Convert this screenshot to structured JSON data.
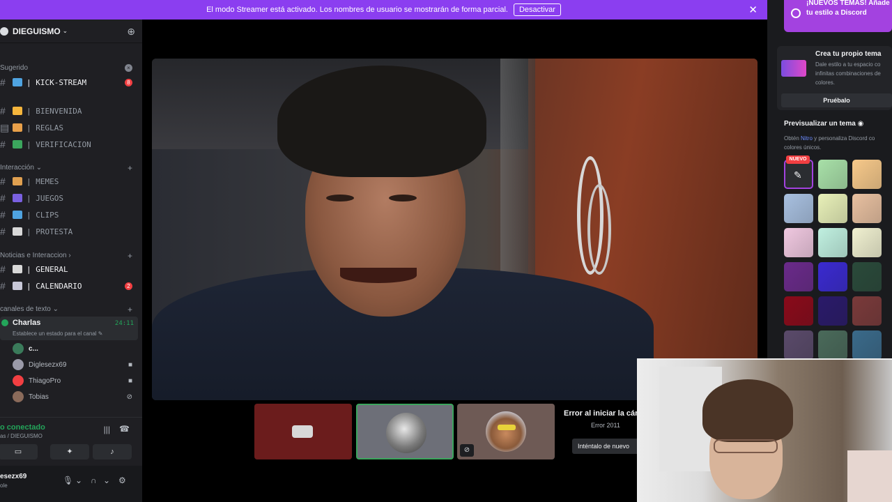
{
  "banner": {
    "text": "El modo Streamer está activado. Los nombres de usuario se mostrarán de forma parcial.",
    "button": "Desactivar",
    "close": "✕"
  },
  "server": {
    "name": "DIEGUISMO",
    "chevron": "⌄"
  },
  "categories": {
    "sugerido": "Sugerido",
    "interaccion": "Interacción",
    "noticias": "Noticias e Interaccion",
    "canales_texto": "canales de texto"
  },
  "channels": [
    {
      "name": "| KICK-STREAM",
      "emoji_color": "#4fa3e0",
      "badge": "8"
    },
    {
      "name": "| BIENVENIDA",
      "emoji_color": "#f5b53c"
    },
    {
      "name": "| REGLAS",
      "emoji_color": "#e8a04a"
    },
    {
      "name": "| VERIFICACION",
      "emoji_color": "#3ba55d"
    },
    {
      "name": "| MEMES",
      "emoji_color": "#e0a050"
    },
    {
      "name": "| JUEGOS",
      "emoji_color": "#7a60e0"
    },
    {
      "name": "| CLIPS",
      "emoji_color": "#4fa3e0"
    },
    {
      "name": "| PROTESTA",
      "emoji_color": "#d8d8d8"
    },
    {
      "name": "| GENERAL",
      "emoji_color": "#d8d8d8"
    },
    {
      "name": "| CALENDARIO",
      "emoji_color": "#c8c8d8",
      "badge": "2"
    }
  ],
  "voice_channel": {
    "name": "Charlas",
    "timer": "24:11",
    "status": "Establece un estado para el canal ✎"
  },
  "voice_users": [
    {
      "name": "c...",
      "avatar_color": "#3a7a5a"
    },
    {
      "name": "Diglesezx69",
      "avatar_color": "#9a9aa8"
    },
    {
      "name": "ThiagoPro",
      "avatar_color": "#f23f42"
    },
    {
      "name": "Tobias",
      "avatar_color": "#8a6a5a"
    }
  ],
  "voice_connection": {
    "label": "o conectado",
    "sub": "as / DIEGUISMO"
  },
  "user": {
    "name": "esezx69",
    "status": "ole"
  },
  "stage": {
    "error_title": "Error al iniciar la cám",
    "error_code": "Error 2011",
    "retry": "Inténtalo de nuevo"
  },
  "right": {
    "promo": "¡NUEVOS TEMAS! Añade tu estilo a Discord",
    "card_title": "Crea tu propio tema",
    "card_desc": "Dale estilo a tu espacio co infinitas combinaciones de colores.",
    "card_button": "Pruébalo",
    "preview_title": "Previsualizar un tema",
    "preview_prefix": "Obtén ",
    "preview_nitro": "Nitro",
    "preview_suffix": " y personaliza Discord co colores únicos.",
    "nuevo": "NUEVO"
  },
  "theme_swatches": [
    "#2b2d31",
    "#a8e0a8",
    "#f7c98a",
    "#a8c0e0",
    "#e8f0b8",
    "#e8c0a0",
    "#f0c8e0",
    "#c0f0e0",
    "#f0f0d0",
    "#6a2a8a",
    "#3a2ad0",
    "#2a4a3a",
    "#8a0a1a",
    "#2a1a6a",
    "#7a3a3a",
    "#5a4a6a",
    "#4a6a5a",
    "#3a6a8a"
  ],
  "colors": {
    "banner": "#8b3ef0",
    "online": "#23a55a",
    "badge": "#f23f42",
    "accent": "#a342e0"
  }
}
